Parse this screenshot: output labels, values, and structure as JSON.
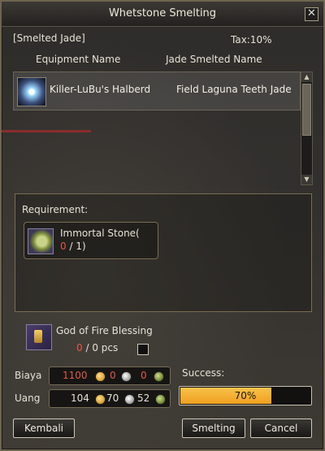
{
  "window": {
    "title": "Whetstone Smelting"
  },
  "header": {
    "tab_label": "[Smelted Jade]",
    "tax_label": "Tax:10%"
  },
  "columns": {
    "equipment": "Equipment Name",
    "jade": "Jade Smelted Name"
  },
  "list": {
    "rows": [
      {
        "equipment": "Killer-LuBu's Halberd",
        "jade": "Field Laguna Teeth Jade"
      }
    ]
  },
  "requirement": {
    "title": "Requirement:",
    "item_name": "Immortal Stone(",
    "have": "0",
    "need": " / 1)"
  },
  "blessing": {
    "name": "God of Fire Blessing",
    "have": "0",
    "rest": " / 0 pcs"
  },
  "cost": {
    "biaya_label": "Biaya",
    "biaya_gold": "1100",
    "biaya_silver": "0",
    "biaya_copper": "0",
    "uang_label": "Uang",
    "uang_gold": "104",
    "uang_silver": "70",
    "uang_copper": "52"
  },
  "success": {
    "label": "Success:",
    "value_text": "70%",
    "fraction": 0.7
  },
  "buttons": {
    "back": "Kembali",
    "smelt": "Smelting",
    "cancel": "Cancel"
  },
  "colors": {
    "bar_fill": "#f0a020",
    "warn": "#e05a4a"
  }
}
